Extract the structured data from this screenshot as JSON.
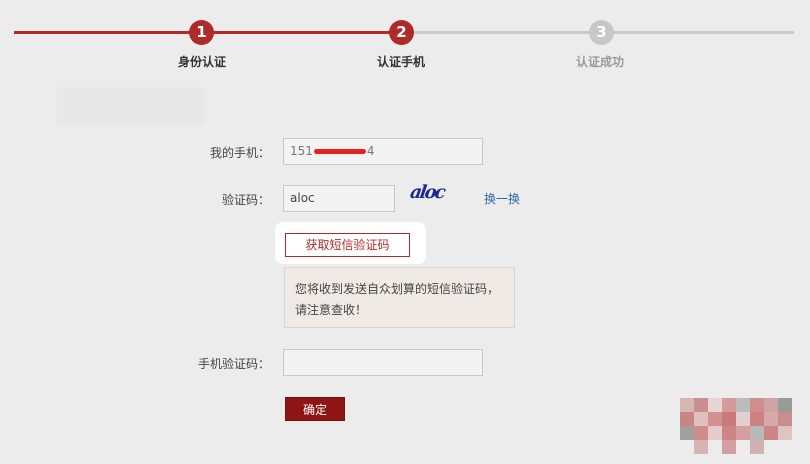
{
  "steps": [
    {
      "number": "1",
      "label": "身份认证",
      "state": "done"
    },
    {
      "number": "2",
      "label": "认证手机",
      "state": "active"
    },
    {
      "number": "3",
      "label": "认证成功",
      "state": "pending"
    }
  ],
  "form": {
    "phone_label": "我的手机：",
    "phone_prefix": "151",
    "phone_suffix": "4",
    "captcha_label": "验证码：",
    "captcha_value": "aloc",
    "captcha_image_text": "aloc",
    "refresh_link": "换一换",
    "send_sms_button": "获取短信验证码",
    "tip_line1": "您将收到发送自众划算的短信验证码，",
    "tip_line2": "请注意查收！",
    "sms_code_label": "手机验证码：",
    "sms_code_value": "",
    "confirm_button": "确定"
  },
  "colors": {
    "accent": "#b02a2a",
    "inactive": "#c7c7c7",
    "link": "#2a6aa8"
  }
}
